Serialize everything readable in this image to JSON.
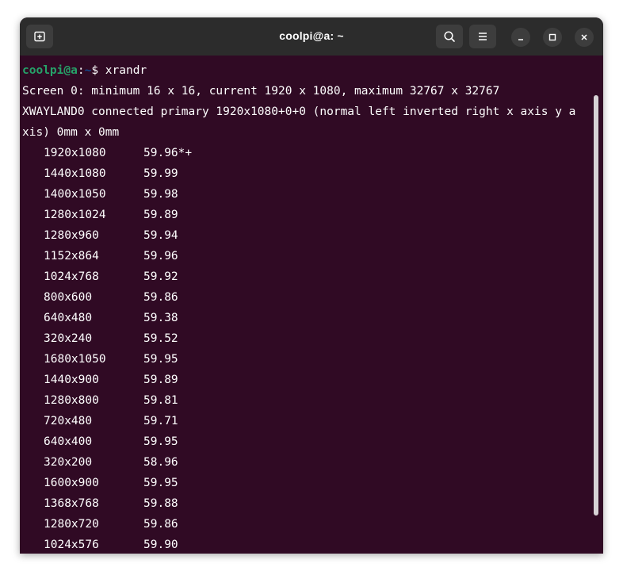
{
  "window": {
    "title": "coolpi@a: ~"
  },
  "icons": {
    "new_tab": "new-tab-icon",
    "search": "search-icon",
    "menu": "hamburger-menu-icon",
    "minimize": "minimize-icon",
    "maximize": "maximize-icon",
    "close": "close-icon"
  },
  "colors": {
    "terminal_bg": "#300a24",
    "titlebar_bg": "#2c2c2c",
    "prompt_user": "#26a269",
    "prompt_path": "#12488b",
    "text": "#ffffff"
  },
  "terminal": {
    "prompt": {
      "user_host": "coolpi@a",
      "colon": ":",
      "path": "~",
      "symbol": "$ ",
      "command": "xrandr"
    },
    "output_lines": [
      "Screen 0: minimum 16 x 16, current 1920 x 1080, maximum 32767 x 32767",
      "XWAYLAND0 connected primary 1920x1080+0+0 (normal left inverted right x axis y a",
      "xis) 0mm x 0mm"
    ],
    "modes": [
      {
        "res": "1920x1080",
        "rate": "59.96*+"
      },
      {
        "res": "1440x1080",
        "rate": "59.99"
      },
      {
        "res": "1400x1050",
        "rate": "59.98"
      },
      {
        "res": "1280x1024",
        "rate": "59.89"
      },
      {
        "res": "1280x960",
        "rate": "59.94"
      },
      {
        "res": "1152x864",
        "rate": "59.96"
      },
      {
        "res": "1024x768",
        "rate": "59.92"
      },
      {
        "res": "800x600",
        "rate": "59.86"
      },
      {
        "res": "640x480",
        "rate": "59.38"
      },
      {
        "res": "320x240",
        "rate": "59.52"
      },
      {
        "res": "1680x1050",
        "rate": "59.95"
      },
      {
        "res": "1440x900",
        "rate": "59.89"
      },
      {
        "res": "1280x800",
        "rate": "59.81"
      },
      {
        "res": "720x480",
        "rate": "59.71"
      },
      {
        "res": "640x400",
        "rate": "59.95"
      },
      {
        "res": "320x200",
        "rate": "58.96"
      },
      {
        "res": "1600x900",
        "rate": "59.95"
      },
      {
        "res": "1368x768",
        "rate": "59.88"
      },
      {
        "res": "1280x720",
        "rate": "59.86"
      },
      {
        "res": "1024x576",
        "rate": "59.90"
      }
    ]
  }
}
